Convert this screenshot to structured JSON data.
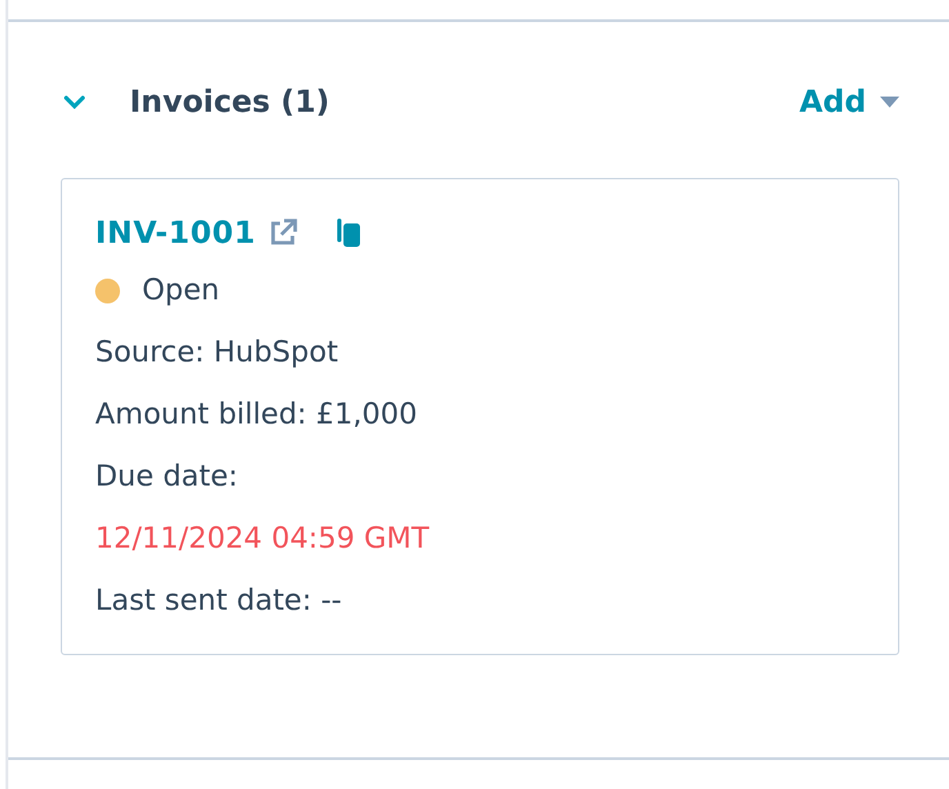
{
  "section": {
    "title": "Invoices (1)",
    "expanded": true,
    "add_label": "Add"
  },
  "invoices": [
    {
      "number": "INV-1001",
      "status": {
        "label": "Open",
        "color": "#f5c26b"
      },
      "fields": [
        {
          "kind": "plain",
          "text": "Source: HubSpot"
        },
        {
          "kind": "plain",
          "text": "Amount billed: £1,000"
        },
        {
          "kind": "plain",
          "text": "Due date:"
        },
        {
          "kind": "alert",
          "text": "12/11/2024 04:59 GMT"
        },
        {
          "kind": "plain",
          "text": "Last sent date: --"
        }
      ]
    }
  ]
}
